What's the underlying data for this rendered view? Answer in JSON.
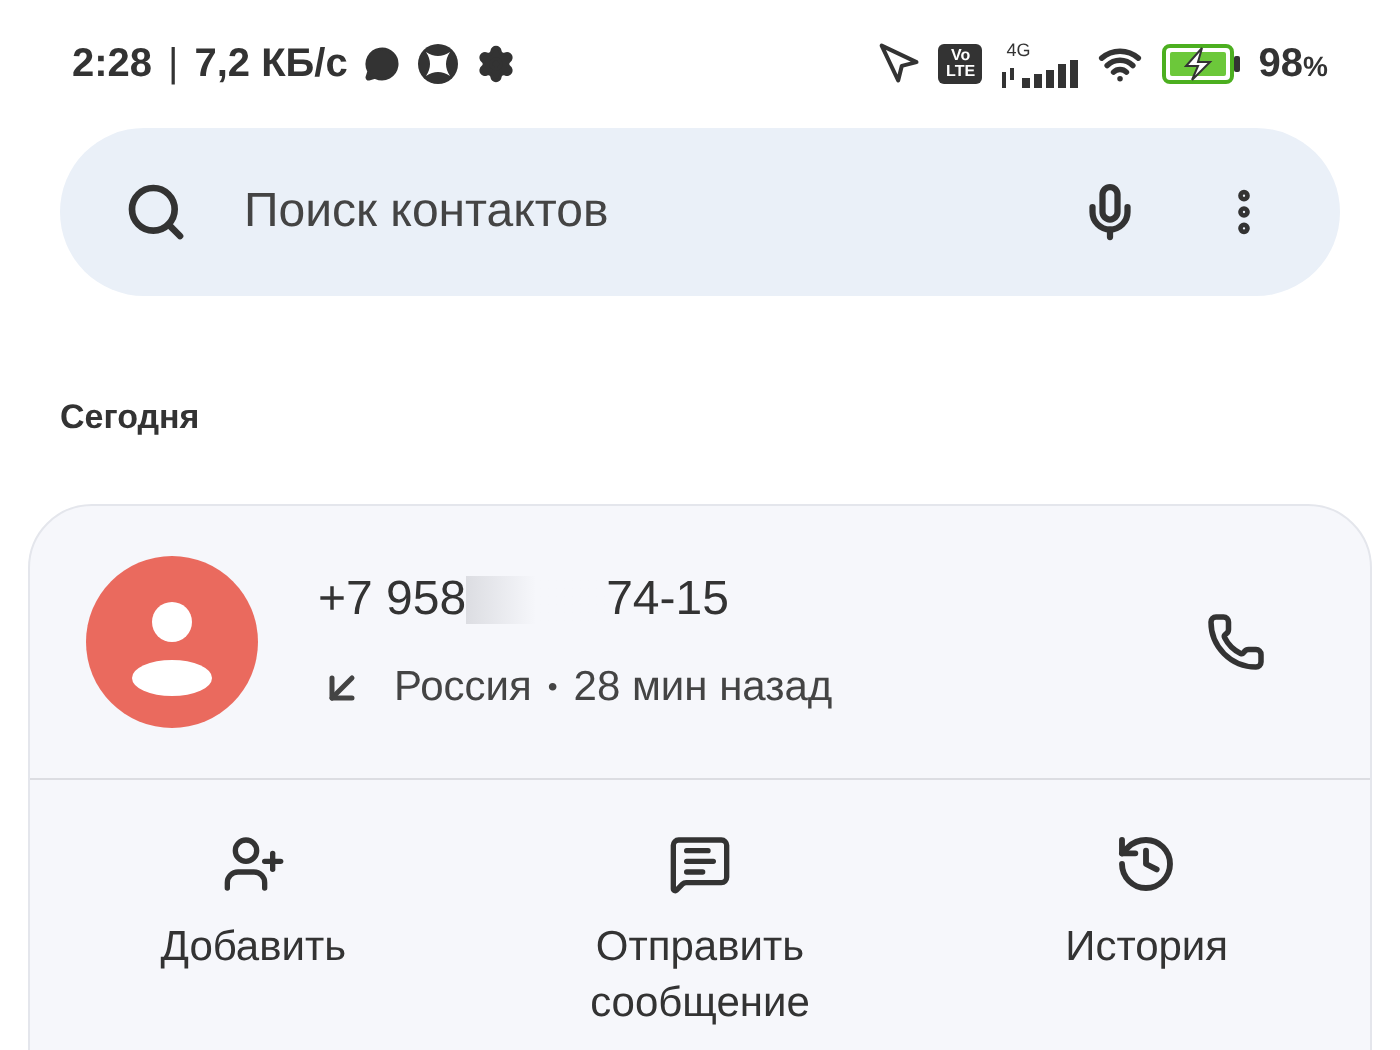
{
  "status_bar": {
    "time": "2:28",
    "separator": "|",
    "speed": "7,2 КБ/с",
    "network_type": "4G",
    "volte_top": "Vo",
    "volte_bottom": "LTE",
    "battery": "98",
    "battery_unit": "%"
  },
  "search": {
    "placeholder": "Поиск контактов"
  },
  "section_title": "Сегодня",
  "call": {
    "number_start": "+7 958",
    "number_end": "74-15",
    "incoming": true,
    "country": "Россия",
    "separator": "•",
    "time": "28 мин назад"
  },
  "actions": [
    {
      "kind": "add",
      "lines": [
        "Добавить"
      ]
    },
    {
      "kind": "message",
      "lines": [
        "Отправить",
        "сообщение"
      ]
    },
    {
      "kind": "history",
      "lines": [
        "История"
      ]
    }
  ]
}
